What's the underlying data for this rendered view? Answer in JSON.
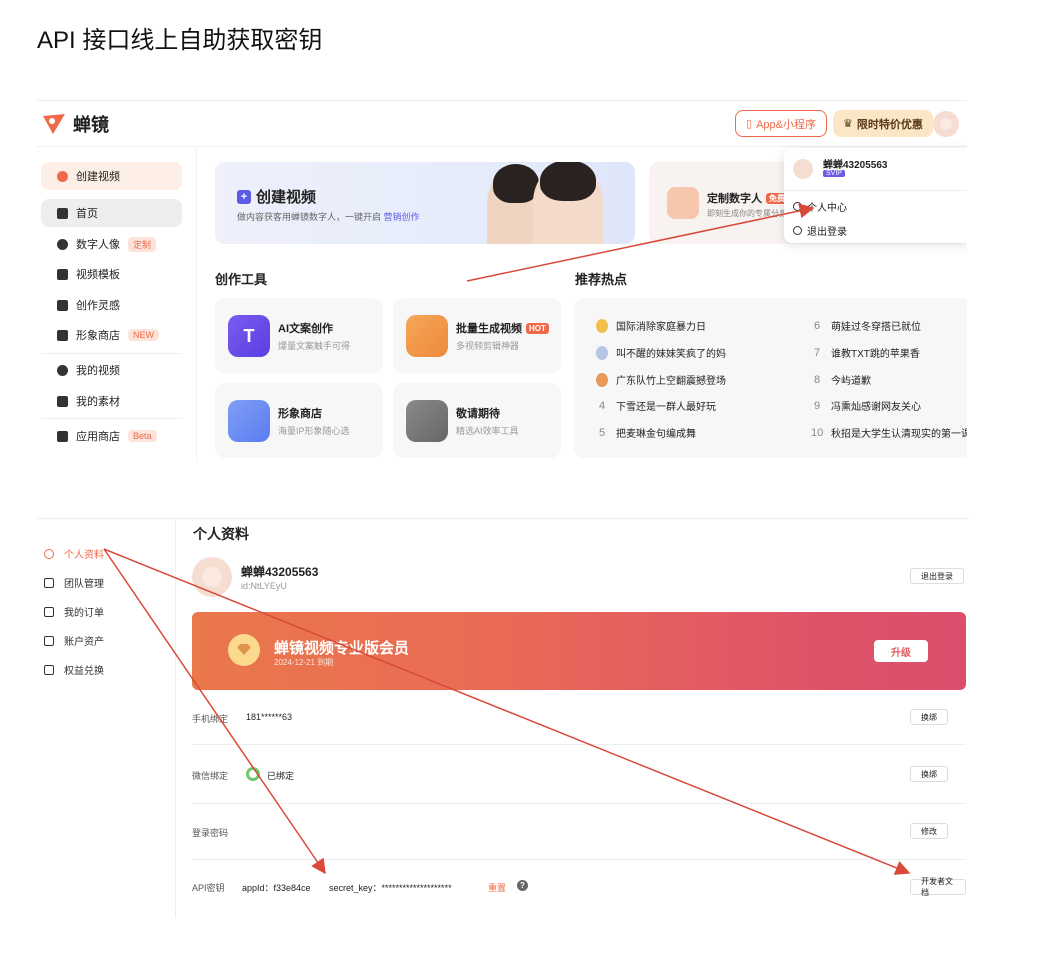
{
  "doc": {
    "title": "API 接口线上自助获取密钥"
  },
  "header": {
    "logo_text": "蝉镜",
    "app_btn": "App&小程序",
    "promo_btn": "限时特价优惠"
  },
  "sidebar": {
    "create": "创建视频",
    "items": [
      {
        "label": "首页"
      },
      {
        "label": "数字人像",
        "tag": "定制"
      },
      {
        "label": "视频模板"
      },
      {
        "label": "创作灵感"
      },
      {
        "label": "形象商店",
        "tag": "NEW"
      },
      {
        "label": "我的视频"
      },
      {
        "label": "我的素材"
      },
      {
        "label": "应用商店",
        "tag": "Beta"
      }
    ]
  },
  "banner": {
    "title": "创建视频",
    "sub": "做内容获客用蝉镜数字人，一键开启",
    "sub_link": "营销创作",
    "custom_title": "定制数字人",
    "custom_tag": "免费",
    "custom_sub": "即刻生成你的专属分身"
  },
  "tools": {
    "section_title": "创作工具",
    "items": [
      {
        "title": "AI文案创作",
        "sub": "爆量文案触手可得"
      },
      {
        "title": "批量生成视频",
        "tag": "HOT",
        "sub": "多视频剪辑神器"
      },
      {
        "title": "形象商店",
        "sub": "海量IP形象随心选"
      },
      {
        "title": "敬请期待",
        "sub": "精选AI效率工具"
      }
    ]
  },
  "hot": {
    "section_title": "推荐热点",
    "left": [
      {
        "rank": "1",
        "text": "国际消除家庭暴力日"
      },
      {
        "rank": "2",
        "text": "叫不醒的妹妹笑疯了的妈"
      },
      {
        "rank": "3",
        "text": "广东队竹上空翻震撼登场"
      },
      {
        "rank": "4",
        "text": "下雪还是一群人最好玩"
      },
      {
        "rank": "5",
        "text": "把麦琳金句编成舞"
      }
    ],
    "right": [
      {
        "rank": "6",
        "text": "萌娃过冬穿搭已就位"
      },
      {
        "rank": "7",
        "text": "谁教TXT跳的苹果香"
      },
      {
        "rank": "8",
        "text": "今屿道歉"
      },
      {
        "rank": "9",
        "text": "冯熏灿感谢网友关心"
      },
      {
        "rank": "10",
        "text": "秋招是大学生认清现实的第一课"
      }
    ]
  },
  "dropdown": {
    "name": "蝉蝉43205563",
    "badge": "SVIP",
    "profile": "个人中心",
    "logout": "退出登录"
  },
  "profile_sidebar": {
    "items": [
      "个人资料",
      "团队管理",
      "我的订单",
      "账户资产",
      "权益兑换"
    ]
  },
  "profile": {
    "page_title": "个人资料",
    "name": "蝉蝉43205563",
    "id": "id:NtLYEyU",
    "logout_btn": "退出登录",
    "vip_title": "蝉镜视频专业版会员",
    "vip_expire": "2024-12-21 到期",
    "upgrade_btn": "升级",
    "phone_label": "手机绑定",
    "phone_value": "181******63",
    "phone_btn": "换绑",
    "wechat_label": "微信绑定",
    "wechat_value": "已绑定",
    "wechat_btn": "换绑",
    "pwd_label": "登录密码",
    "pwd_btn": "修改",
    "api_label": "API密钥",
    "api_appid": "appId：f33e84ce",
    "api_secret": "secret_key：********************",
    "api_reset": "重置",
    "api_help": "?",
    "api_doc_btn": "开发者文档"
  },
  "colors": {
    "accent": "#ef6a4a",
    "arrow": "#d9493a"
  }
}
